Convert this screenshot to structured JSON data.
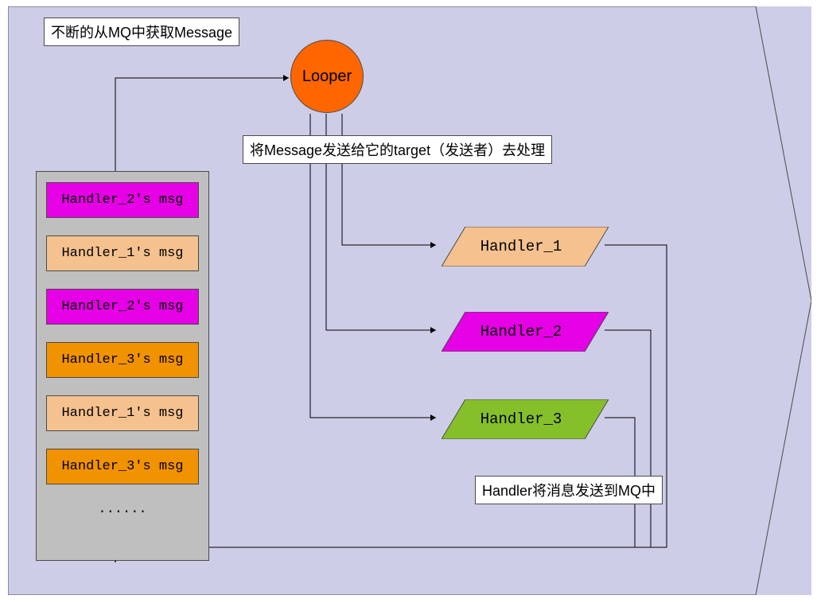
{
  "labels": {
    "fetch_from_mq": "不断的从MQ中获取Message",
    "send_to_target": "将Message发送给它的target（发送者）去处理",
    "handler_sends_to_mq": "Handler将消息发送到MQ中"
  },
  "looper": {
    "label": "Looper"
  },
  "queue": {
    "items": [
      {
        "label": "Handler_2's msg",
        "color": "magenta"
      },
      {
        "label": "Handler_1's msg",
        "color": "peach"
      },
      {
        "label": "Handler_2's msg",
        "color": "magenta"
      },
      {
        "label": "Handler_3's msg",
        "color": "orange"
      },
      {
        "label": "Handler_1's msg",
        "color": "peach"
      },
      {
        "label": "Handler_3's msg",
        "color": "orange"
      }
    ],
    "ellipsis": "......"
  },
  "handlers": [
    {
      "label": "Handler_1",
      "color": "#F5C18F"
    },
    {
      "label": "Handler_2",
      "color": "#E500E5"
    },
    {
      "label": "Handler_3",
      "color": "#85C02A"
    }
  ]
}
